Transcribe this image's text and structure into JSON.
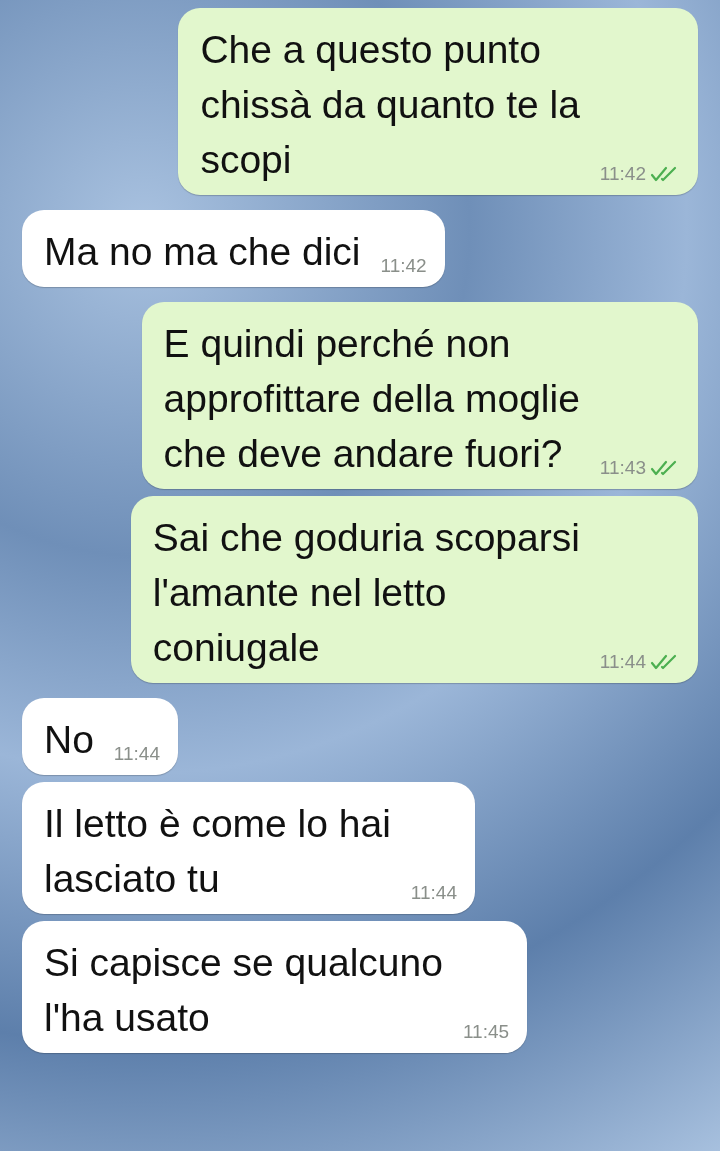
{
  "messages": [
    {
      "outgoing": true,
      "lines": [
        "Che a questo punto",
        "chissà da quanto te la",
        "scopi"
      ],
      "time": "11:42",
      "read": true
    },
    {
      "outgoing": false,
      "lines": [
        "Ma no ma che dici"
      ],
      "time": "11:42"
    },
    {
      "outgoing": true,
      "lines": [
        "E quindi perché non",
        "approfittare della moglie",
        "che deve andare fuori?"
      ],
      "time": "11:43",
      "read": true
    },
    {
      "outgoing": true,
      "lines": [
        "Sai che goduria scoparsi",
        "l'amante nel letto",
        "coniugale"
      ],
      "time": "11:44",
      "read": true
    },
    {
      "outgoing": false,
      "lines": [
        "No"
      ],
      "time": "11:44"
    },
    {
      "outgoing": false,
      "lines": [
        "Il letto è come lo hai",
        "lasciato tu"
      ],
      "time": "11:44"
    },
    {
      "outgoing": false,
      "lines": [
        "Si capisce se qualcuno",
        "l'ha usato"
      ],
      "time": "11:45"
    }
  ]
}
